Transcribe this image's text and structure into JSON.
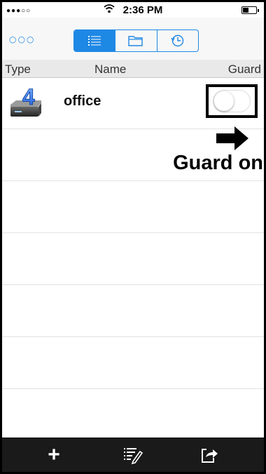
{
  "status_bar": {
    "signal": "●●●○○",
    "time": "2:36 PM"
  },
  "navbar": {
    "more_label": "○○○",
    "segments": [
      {
        "icon": "list-icon",
        "active": true
      },
      {
        "icon": "folder-icon",
        "active": false
      },
      {
        "icon": "history-icon",
        "active": false
      }
    ]
  },
  "table": {
    "headers": {
      "type": "Type",
      "name": "Name",
      "guard": "Guard"
    },
    "rows": [
      {
        "icon": "device-icon",
        "icon_number": "4",
        "name": "office",
        "guard_on": false
      }
    ]
  },
  "annotation": {
    "text": "Guard on"
  },
  "toolbar": {
    "add_label": "+"
  },
  "colors": {
    "accent": "#1e88e5",
    "toolbar_bg": "#1a1a1a"
  }
}
